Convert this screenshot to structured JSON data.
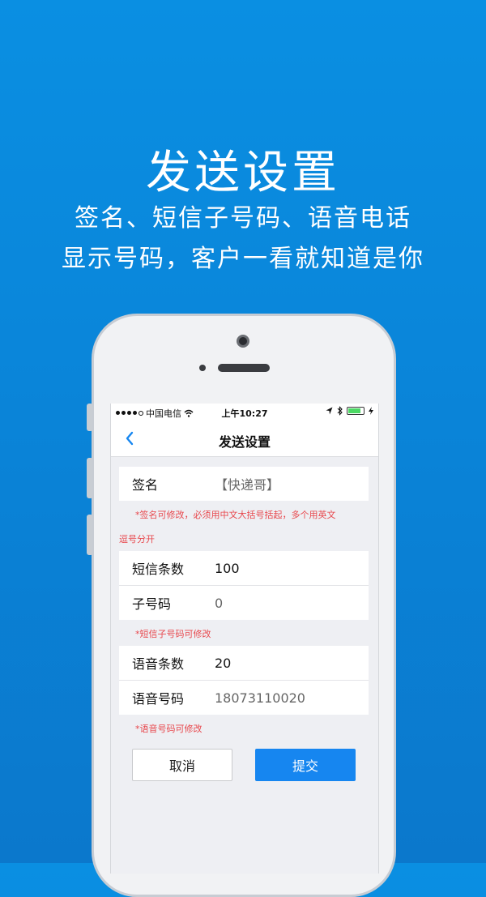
{
  "promo": {
    "title": "发送设置",
    "line1": "签名、短信子号码、语音电话",
    "line2": "显示号码，客户一看就知道是你"
  },
  "status_bar": {
    "carrier": "中国电信",
    "time": "上午10:27",
    "battery_level": 0.85,
    "battery_color": "#4cd964"
  },
  "nav": {
    "back_icon": "chevron-left-icon",
    "title": "发送设置"
  },
  "form": {
    "signature": {
      "label": "签名",
      "value": "【快递哥】"
    },
    "signature_hint_1": "*签名可修改，必须用中文大括号括起，多个用英文",
    "signature_hint_2": "逗号分开",
    "sms_count": {
      "label": "短信条数",
      "value": "100"
    },
    "sub_number": {
      "label": "子号码",
      "value": "0"
    },
    "sub_number_hint": "*短信子号码可修改",
    "voice_count": {
      "label": "语音条数",
      "value": "20"
    },
    "voice_number": {
      "label": "语音号码",
      "value": "18073110020"
    },
    "voice_number_hint": "*语音号码可修改"
  },
  "buttons": {
    "cancel": "取消",
    "submit": "提交"
  },
  "colors": {
    "accent": "#1686f0",
    "hint": "#e8474c",
    "background": "#0a86da"
  }
}
